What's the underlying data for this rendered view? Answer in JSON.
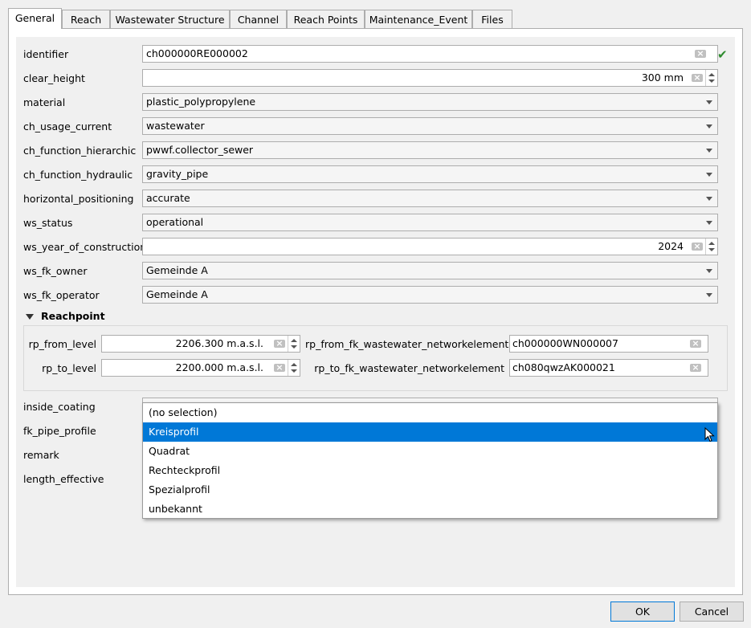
{
  "tabs": [
    {
      "label": "General"
    },
    {
      "label": "Reach"
    },
    {
      "label": "Wastewater Structure"
    },
    {
      "label": "Channel"
    },
    {
      "label": "Reach Points"
    },
    {
      "label": "Maintenance_Event"
    },
    {
      "label": "Files"
    }
  ],
  "fields": {
    "identifier": {
      "label": "identifier",
      "value": "ch000000RE000002"
    },
    "clear_height": {
      "label": "clear_height",
      "value": "300 mm"
    },
    "material": {
      "label": "material",
      "value": "plastic_polypropylene"
    },
    "ch_usage_current": {
      "label": "ch_usage_current",
      "value": "wastewater"
    },
    "ch_function_hierarchic": {
      "label": "ch_function_hierarchic",
      "value": "pwwf.collector_sewer"
    },
    "ch_function_hydraulic": {
      "label": "ch_function_hydraulic",
      "value": "gravity_pipe"
    },
    "horizontal_positioning": {
      "label": "horizontal_positioning",
      "value": "accurate"
    },
    "ws_status": {
      "label": "ws_status",
      "value": "operational"
    },
    "ws_year_of_construction": {
      "label": "ws_year_of_construction",
      "value": "2024"
    },
    "ws_fk_owner": {
      "label": "ws_fk_owner",
      "value": "Gemeinde A"
    },
    "ws_fk_operator": {
      "label": "ws_fk_operator",
      "value": "Gemeinde A"
    }
  },
  "reachpoint": {
    "title": "Reachpoint",
    "rp_from_level": {
      "label": "rp_from_level",
      "value": "2206.300 m.a.s.l."
    },
    "rp_to_level": {
      "label": "rp_to_level",
      "value": "2200.000 m.a.s.l."
    },
    "rp_from_fk": {
      "label": "rp_from_fk_wastewater_networkelement",
      "value": "ch000000WN000007"
    },
    "rp_to_fk": {
      "label": "rp_to_fk_wastewater_networkelement",
      "value": "ch080qwzAK000021"
    }
  },
  "lower_fields": {
    "inside_coating": {
      "label": "inside_coating"
    },
    "fk_pipe_profile": {
      "label": "fk_pipe_profile"
    },
    "remark": {
      "label": "remark"
    },
    "length_effective": {
      "label": "length_effective"
    }
  },
  "dropdown": {
    "options": [
      "(no selection)",
      "Kreisprofil",
      "Quadrat",
      "Rechteckprofil",
      "Spezialprofil",
      "unbekannt"
    ],
    "selected": "Kreisprofil"
  },
  "buttons": {
    "ok": "OK",
    "cancel": "Cancel"
  },
  "colors": {
    "selection": "#0078d7",
    "check": "#2e8b2e"
  }
}
